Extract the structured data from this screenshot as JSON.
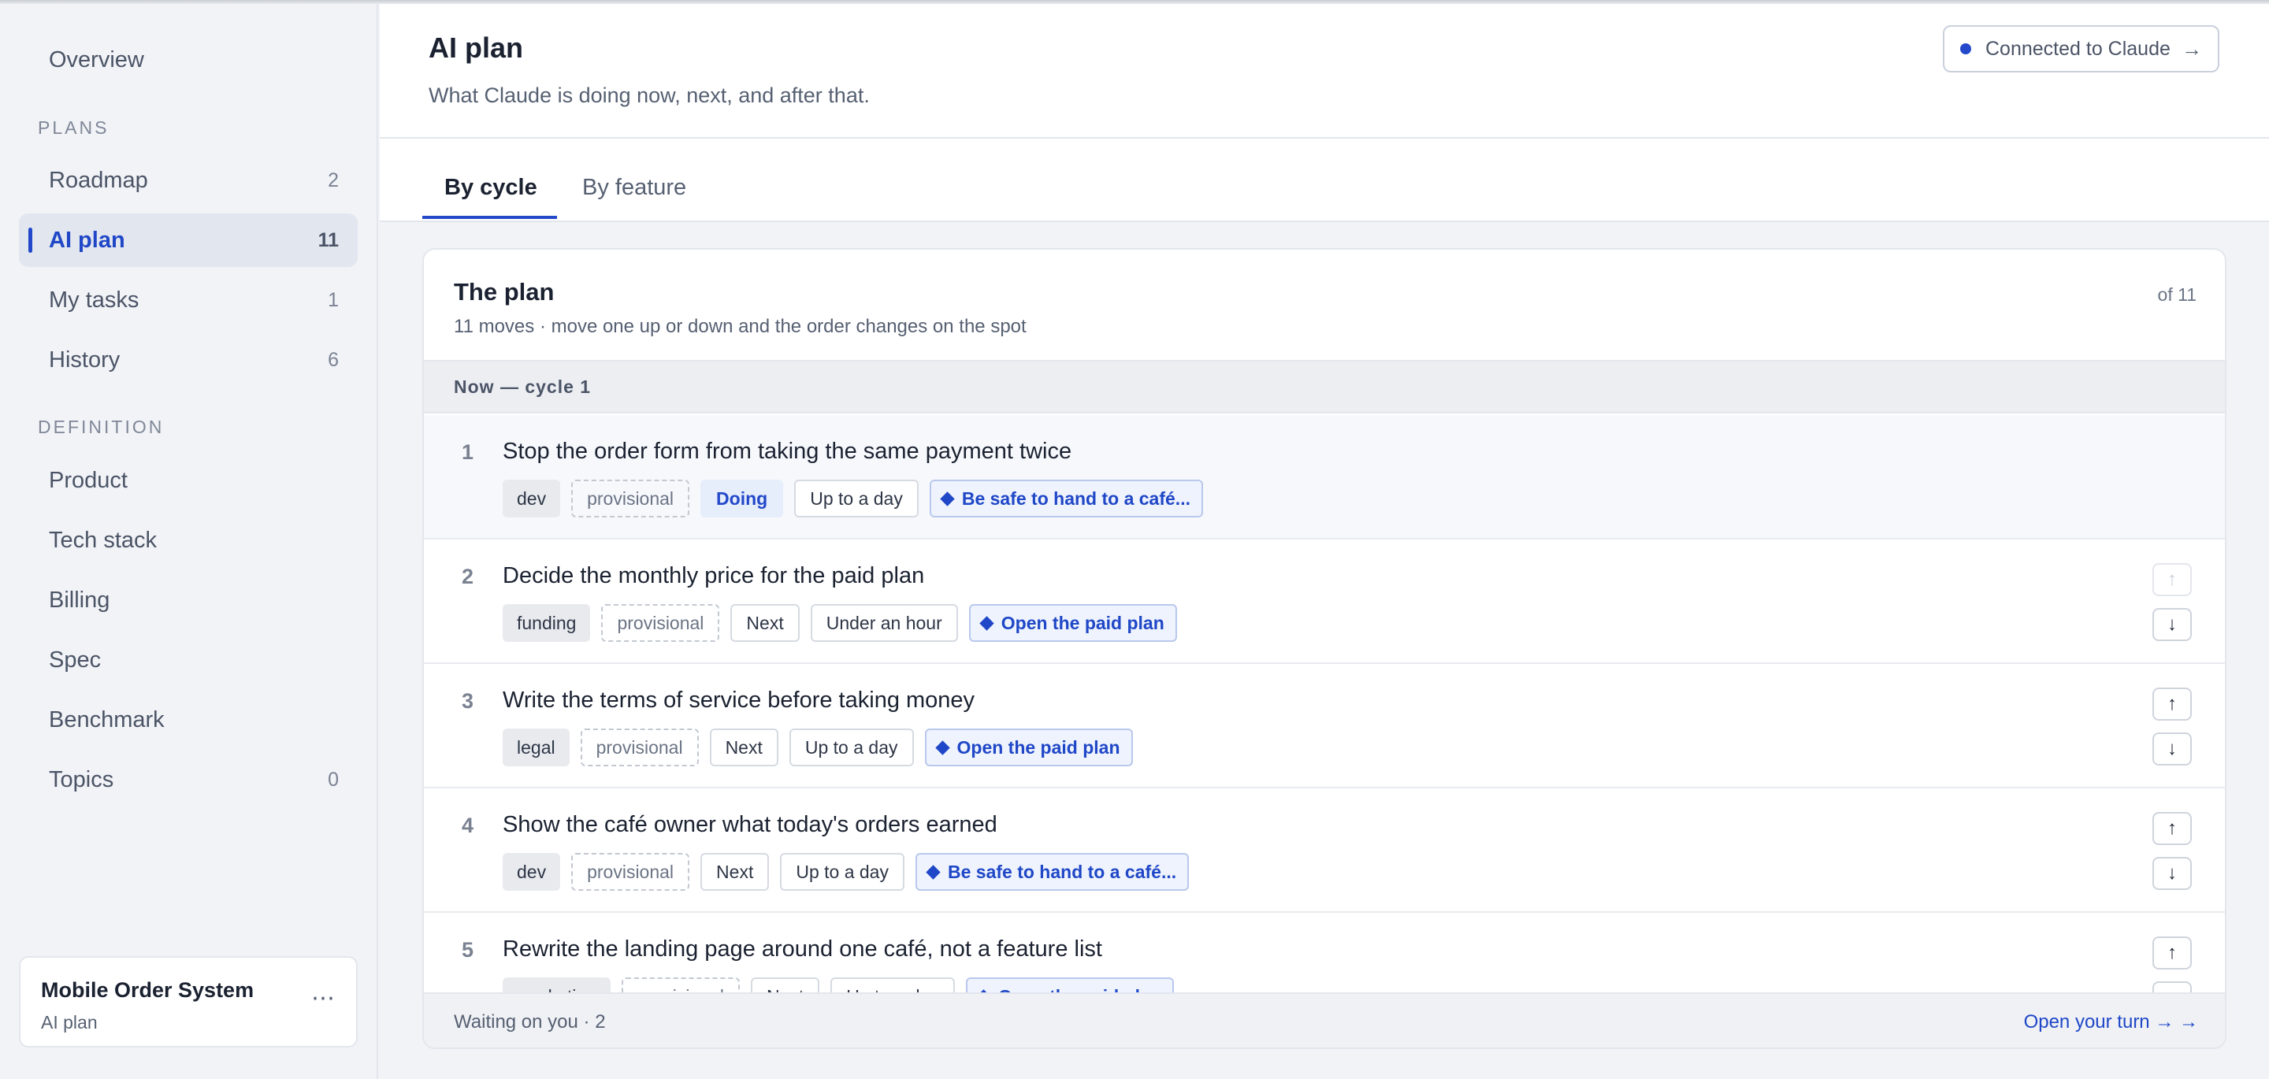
{
  "sidebar": {
    "items": [
      {
        "label": "Overview",
        "count": ""
      },
      {
        "label": "Roadmap",
        "count": "2"
      },
      {
        "label": "AI plan",
        "count": "11"
      },
      {
        "label": "My tasks",
        "count": "1"
      },
      {
        "label": "History",
        "count": "6"
      },
      {
        "label": "Product",
        "count": ""
      },
      {
        "label": "Tech stack",
        "count": ""
      },
      {
        "label": "Billing",
        "count": ""
      },
      {
        "label": "Spec",
        "count": ""
      },
      {
        "label": "Benchmark",
        "count": ""
      },
      {
        "label": "Topics",
        "count": "0"
      }
    ],
    "sections": {
      "plans": "PLANS",
      "definition": "DEFINITION"
    },
    "project": {
      "name": "Mobile Order System",
      "sub": "AI plan",
      "more": "⋯"
    }
  },
  "header": {
    "title": "AI plan",
    "subtitle": "What Claude is doing now, next, and after that.",
    "connect_label": "Connected to Claude",
    "connect_arrow": "→"
  },
  "tabs": [
    {
      "label": "By cycle"
    },
    {
      "label": "By feature"
    }
  ],
  "plan": {
    "title": "The plan",
    "subtitle": "11 moves · move one up or down and the order changes on the spot",
    "of_label": "of 11",
    "cycle_label": "Now — cycle 1",
    "rows": [
      {
        "num": "1",
        "title": "Stop the order form from taking the same payment twice",
        "tag": "dev",
        "prov": "provisional",
        "status": "Doing",
        "time": "Up to a day",
        "goal": "Be safe to hand to a café..."
      },
      {
        "num": "2",
        "title": "Decide the monthly price for the paid plan",
        "tag": "funding",
        "prov": "provisional",
        "status": "Next",
        "time": "Under an hour",
        "goal": "Open the paid plan"
      },
      {
        "num": "3",
        "title": "Write the terms of service before taking money",
        "tag": "legal",
        "prov": "provisional",
        "status": "Next",
        "time": "Up to a day",
        "goal": "Open the paid plan"
      },
      {
        "num": "4",
        "title": "Show the café owner what today's orders earned",
        "tag": "dev",
        "prov": "provisional",
        "status": "Next",
        "time": "Up to a day",
        "goal": "Be safe to hand to a café..."
      },
      {
        "num": "5",
        "title": "Rewrite the landing page around one café, not a feature list",
        "tag": "marketing",
        "prov": "provisional",
        "status": "Next",
        "time": "Up to a day",
        "goal": "Open the paid plan"
      }
    ],
    "up_arrow": "↑",
    "down_arrow": "↓"
  },
  "footer": {
    "waiting": "Waiting on you · 2",
    "open_turn": "Open your turn → →"
  }
}
